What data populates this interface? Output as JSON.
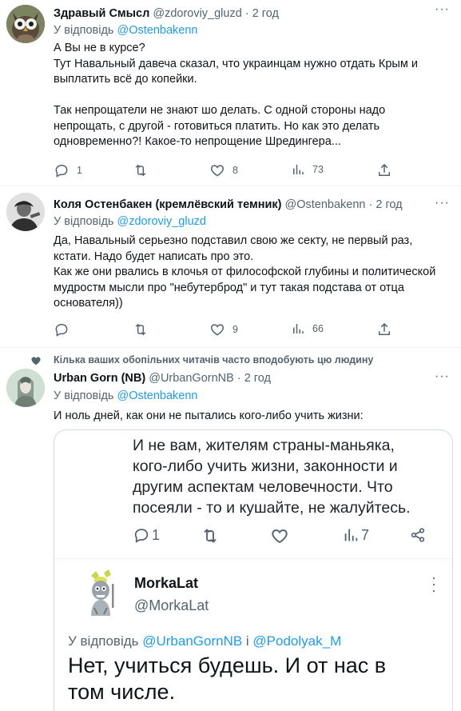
{
  "tweets": [
    {
      "name": "Здравый Смысл",
      "handle": "@zdoroviy_gluzd",
      "sep": " · ",
      "time": "2 год",
      "reply_prefix": "У відповідь ",
      "reply_to": "@Ostenbakenn",
      "lines": [
        "А Вы не в курсе?",
        "Тут Навальный давеча сказал, что украинцам нужно отдать Крым и",
        "выплатить всё до копейки.",
        "",
        "Так непрощатели не знают шо делать. С одной стороны надо",
        "непрощать, с другой - готовиться платить. Но как это делать",
        "одновременно?! Какое-то непрощение Шредингера..."
      ],
      "replies": "1",
      "retweets": "",
      "likes": "8",
      "views": "73"
    },
    {
      "name": "Коля Остенбакен (кремлёвский темник)",
      "handle": "@Ostenbakenn",
      "sep": " · ",
      "time": "2 год",
      "reply_prefix": "У відповідь ",
      "reply_to": "@zdoroviy_gluzd",
      "lines": [
        "Да, Навальный серьезно подставил свою же секту, не первый раз,",
        "кстати. Надо будет написать про это.",
        "Как же они рвались в клочья от философской глубины и политической",
        "мудростм мысли про \"небутерброд\" и тут такая подстава от отца",
        "основателя))"
      ],
      "replies": "",
      "retweets": "",
      "likes": "9",
      "views": "66"
    },
    {
      "social_context": "Кілька ваших обопільних читачів часто вподобують цю людину",
      "name": "Urban Gorn (NB)",
      "handle": "@UrbanGornNB",
      "sep": " · ",
      "time": "2 год",
      "reply_prefix": "У відповідь ",
      "reply_to": "@Ostenbakenn",
      "lines": [
        "И ноль дней, как они не пытались кого-либо учить жизни:"
      ]
    }
  ],
  "embedded": {
    "lines": [
      "И не вам, жителям страны-маньяка,",
      "кого-либо учить жизни, законности и",
      "другим аспектам человечности. Что",
      "посеяли - то и кушайте, не жалуйтесь."
    ],
    "replies": "1",
    "views": "7",
    "author_name": "MorkaLat",
    "author_handle": "@MorkaLat",
    "reply_prefix": "У відповідь ",
    "reply_to_1": "@UrbanGornNB",
    "reply_join": " і ",
    "reply_to_2": "@Podolyak_M",
    "body_lines": [
      "Нет, учиться будешь. И от нас в",
      "том числе."
    ]
  },
  "icons": {
    "reply": "speech-bubble-icon",
    "retweet": "retweet-icon",
    "like": "heart-icon",
    "views": "bar-chart-icon",
    "share": "share-upload-icon",
    "more": "more-dots-icon"
  },
  "colors": {
    "link": "#1d9bf0",
    "muted": "#536471",
    "text": "#0f1419",
    "divider": "#eff3f4"
  }
}
